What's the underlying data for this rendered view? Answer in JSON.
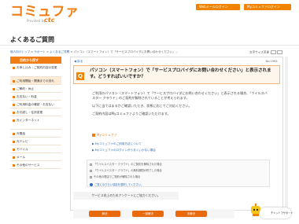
{
  "header": {
    "logo_main": "コミュファ",
    "logo_sub": "Provided by",
    "logo_ctc": "ctc",
    "buttons": [
      "Webメールログイン",
      "Myコミュファログイン"
    ]
  },
  "page_title": "よくあるご質問",
  "breadcrumb": {
    "items": [
      "個人向けトップ",
      "サポート",
      "よくあるご質問"
    ],
    "current": "パソコン（スマートフォン）で「サービスプロバイダにお問い合わせください」..."
  },
  "font_size": {
    "label": "文字サイズ変更",
    "buttons": [
      "小",
      "大"
    ]
  },
  "sidebar": {
    "title": "目的から探す",
    "items": [
      "お申し込み・ご契約内容の変更",
      "ご利用開始・開通までの流れ",
      "ご解約・休止",
      "お支払い・料金",
      "ご利用料金の確認・お支払い",
      "お引越し・住所変更",
      "光インターネット",
      "光電話",
      "光テレビ",
      "モバイル",
      "メール",
      "その他のサービス"
    ]
  },
  "main": {
    "back": "戻る",
    "number": "No.1981",
    "question": "パソコン（スマートフォン）で「サービスプロバイダにお問い合わせください」と表示されます。どうすればいいですか？",
    "paragraphs": [
      "ご利用のパソコン（スマートフォン）で「サービスプロバイダにお問い合わせください」と表示される場合、「ウイルスバスター クラウド」のご契約が解除されていることが考えられます。",
      "以下に当てはまるかご確認いただき、状態に応じてご対応ください。",
      "ご契約内容はMyコミュファよりご確認いただけます。"
    ],
    "my_link": "Myコミュファ",
    "faq_links": [
      "Myコミュファのご利用方法について",
      "Myコミュファのログインがうまくいかない場合"
    ],
    "notes": [
      "「ウイルスバスター クラウド」のご契約を解除された場合",
      "「ウイルスバスター クラウド」の無料期間が終了した場合",
      "その他の理由でご契約が解除された場合"
    ],
    "alt_link": "ご覧になりたい項目を選択してください。"
  },
  "survey": {
    "prompt": "サービス向上のためアンケートにご協力ください。",
    "buttons": [
      "解決",
      "一部解決",
      "未解決"
    ]
  },
  "chat": {
    "label": "チャットでサポート"
  },
  "colors": {
    "accent": "#ef7d13",
    "link": "#2a6ab7"
  }
}
